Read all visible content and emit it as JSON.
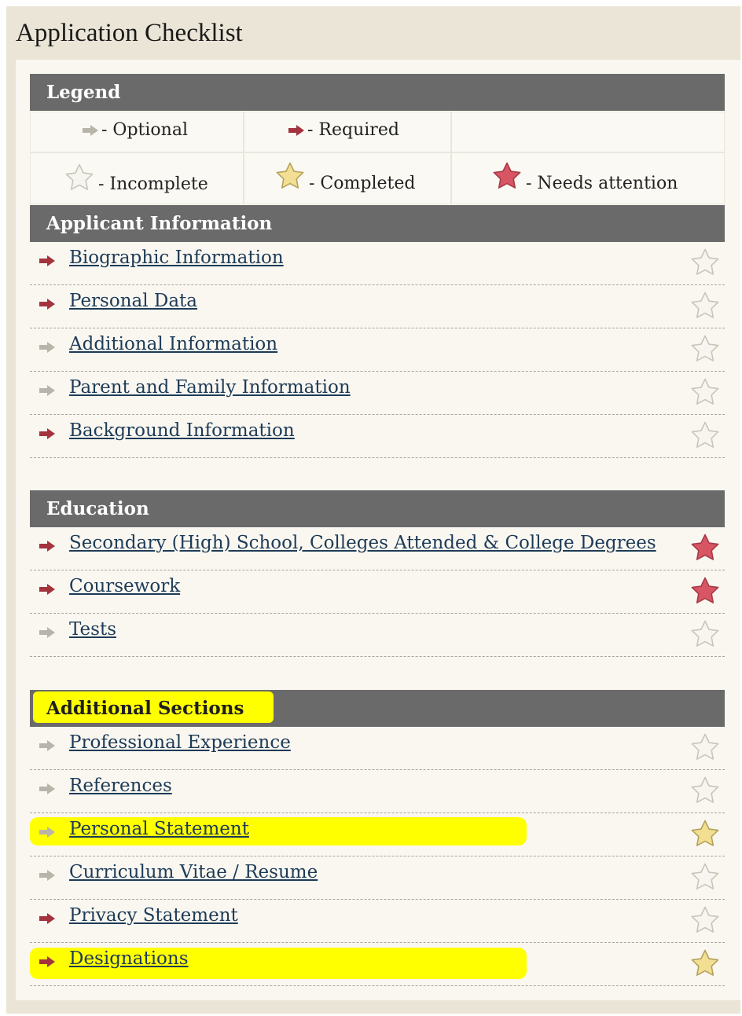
{
  "page": {
    "title": "Application Checklist"
  },
  "legend": {
    "header": "Legend",
    "optional": "- Optional",
    "required": "- Required",
    "incomplete": "- Incomplete",
    "completed": "- Completed",
    "needs_attention": "- Needs attention"
  },
  "colors": {
    "header_bg": "#6a6a6a",
    "optional_arrow": "#b9b4aa",
    "required_arrow": "#a3333d",
    "star_incomplete": "#f7f5ef",
    "star_completed": "#f2df93",
    "star_attention": "#d85563",
    "link": "#1d3b57",
    "highlight": "#ffff00"
  },
  "sections": [
    {
      "title": "Applicant Information",
      "items": [
        {
          "label": "Biographic Information",
          "arrow": "required",
          "status": "incomplete"
        },
        {
          "label": "Personal Data",
          "arrow": "required",
          "status": "incomplete"
        },
        {
          "label": "Additional Information",
          "arrow": "optional",
          "status": "incomplete"
        },
        {
          "label": "Parent and Family Information",
          "arrow": "optional",
          "status": "incomplete"
        },
        {
          "label": "Background Information",
          "arrow": "required",
          "status": "incomplete"
        }
      ]
    },
    {
      "title": "Education",
      "items": [
        {
          "label": "Secondary (High) School, Colleges Attended & College Degrees",
          "arrow": "required",
          "status": "needs-attention"
        },
        {
          "label": "Coursework",
          "arrow": "required",
          "status": "needs-attention"
        },
        {
          "label": "Tests",
          "arrow": "optional",
          "status": "incomplete"
        }
      ]
    },
    {
      "title": "Additional Sections",
      "items": [
        {
          "label": "Professional Experience",
          "arrow": "optional",
          "status": "incomplete"
        },
        {
          "label": "References",
          "arrow": "optional",
          "status": "incomplete"
        },
        {
          "label": "Personal Statement",
          "arrow": "optional",
          "status": "completed"
        },
        {
          "label": "Curriculum Vitae / Resume",
          "arrow": "optional",
          "status": "incomplete"
        },
        {
          "label": "Privacy Statement",
          "arrow": "required",
          "status": "incomplete"
        },
        {
          "label": "Designations",
          "arrow": "required",
          "status": "completed"
        }
      ]
    }
  ]
}
